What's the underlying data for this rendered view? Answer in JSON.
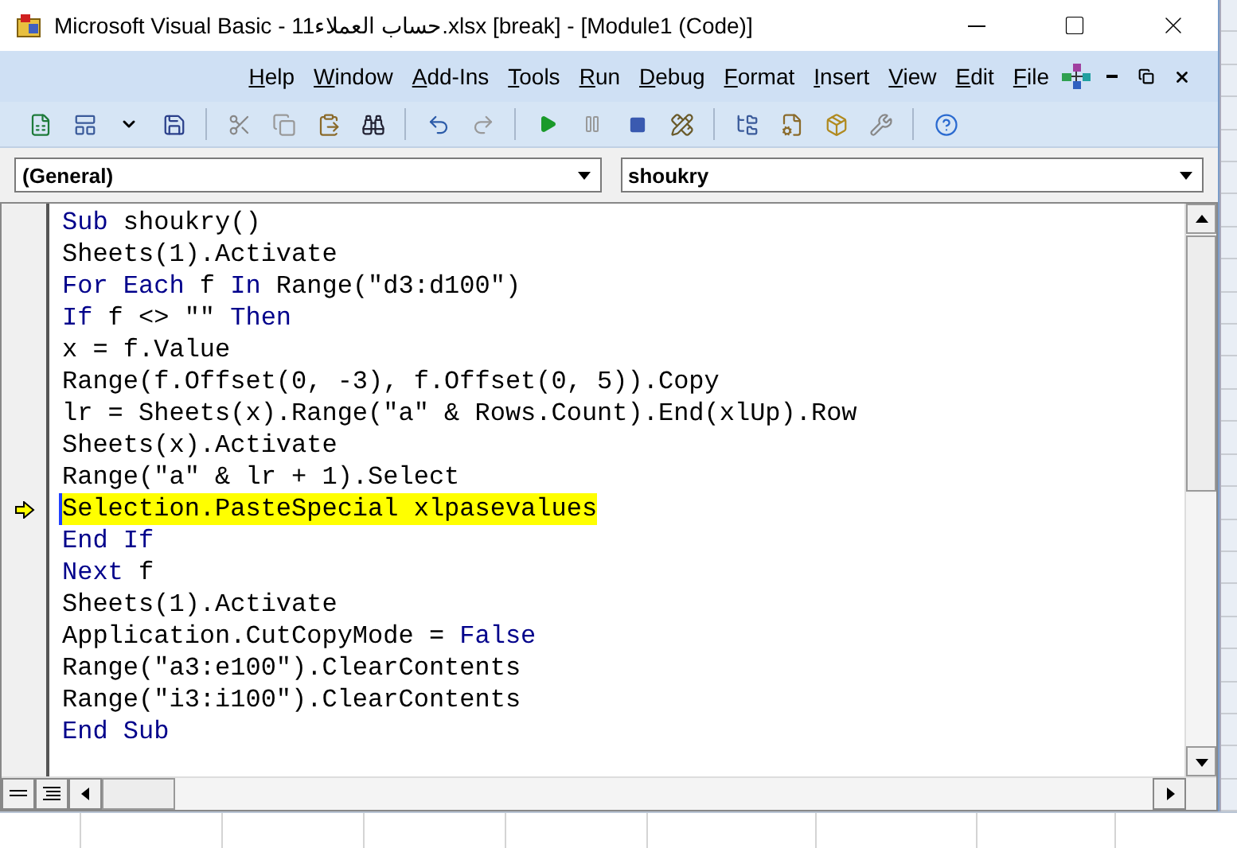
{
  "window": {
    "title": "Microsoft Visual Basic - حساب العملاء11.xlsx [break] - [Module1 (Code)]"
  },
  "menu": [
    "Help",
    "Window",
    "Add-Ins",
    "Tools",
    "Run",
    "Debug",
    "Format",
    "Insert",
    "View",
    "Edit",
    "File"
  ],
  "selectors": {
    "object": "(General)",
    "procedure": "shoukry"
  },
  "code_lines": [
    {
      "current": false,
      "segments": [
        {
          "kind": "keyword",
          "text": "Sub"
        },
        {
          "kind": "plain",
          "text": " shoukry()"
        }
      ]
    },
    {
      "current": false,
      "segments": [
        {
          "kind": "plain",
          "text": "Sheets(1).Activate"
        }
      ]
    },
    {
      "current": false,
      "segments": [
        {
          "kind": "keyword",
          "text": "For Each"
        },
        {
          "kind": "plain",
          "text": " f "
        },
        {
          "kind": "keyword",
          "text": "In"
        },
        {
          "kind": "plain",
          "text": " Range(\"d3:d100\")"
        }
      ]
    },
    {
      "current": false,
      "segments": [
        {
          "kind": "keyword",
          "text": "If"
        },
        {
          "kind": "plain",
          "text": " f <> \"\" "
        },
        {
          "kind": "keyword",
          "text": "Then"
        }
      ]
    },
    {
      "current": false,
      "segments": [
        {
          "kind": "plain",
          "text": "x = f.Value"
        }
      ]
    },
    {
      "current": false,
      "segments": [
        {
          "kind": "plain",
          "text": "Range(f.Offset(0, -3), f.Offset(0, 5)).Copy"
        }
      ]
    },
    {
      "current": false,
      "segments": [
        {
          "kind": "plain",
          "text": "lr = Sheets(x).Range(\"a\" & Rows.Count).End(xlUp).Row"
        }
      ]
    },
    {
      "current": false,
      "segments": [
        {
          "kind": "plain",
          "text": "Sheets(x).Activate"
        }
      ]
    },
    {
      "current": false,
      "segments": [
        {
          "kind": "plain",
          "text": "Range(\"a\" & lr + 1).Select"
        }
      ]
    },
    {
      "current": true,
      "segments": [
        {
          "kind": "plain",
          "text": "Selection.PasteSpecial xlpasevalues"
        }
      ]
    },
    {
      "current": false,
      "segments": [
        {
          "kind": "keyword",
          "text": "End If"
        }
      ]
    },
    {
      "current": false,
      "segments": [
        {
          "kind": "keyword",
          "text": "Next"
        },
        {
          "kind": "plain",
          "text": " f"
        }
      ]
    },
    {
      "current": false,
      "segments": [
        {
          "kind": "plain",
          "text": "Sheets(1).Activate"
        }
      ]
    },
    {
      "current": false,
      "segments": [
        {
          "kind": "plain",
          "text": "Application.CutCopyMode = "
        },
        {
          "kind": "keyword",
          "text": "False"
        }
      ]
    },
    {
      "current": false,
      "segments": [
        {
          "kind": "plain",
          "text": "Range(\"a3:e100\").ClearContents"
        }
      ]
    },
    {
      "current": false,
      "segments": [
        {
          "kind": "plain",
          "text": "Range(\"i3:i100\").ClearContents"
        }
      ]
    },
    {
      "current": false,
      "segments": [
        {
          "kind": "keyword",
          "text": "End Sub"
        }
      ]
    }
  ]
}
